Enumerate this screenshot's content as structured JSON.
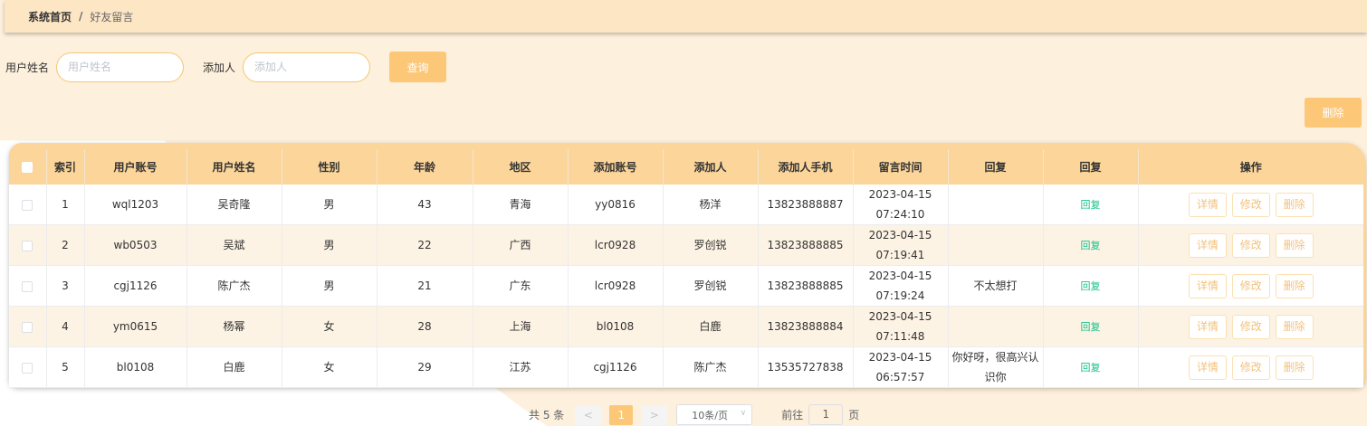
{
  "breadcrumb": {
    "home": "系统首页",
    "separator": "/",
    "current": "好友留言"
  },
  "search": {
    "user_name_label": "用户姓名",
    "user_name_placeholder": "用户姓名",
    "adder_label": "添加人",
    "adder_placeholder": "添加人",
    "query_button": "查询"
  },
  "actions": {
    "delete_button": "删除"
  },
  "table": {
    "headers": [
      "索引",
      "用户账号",
      "用户姓名",
      "性别",
      "年龄",
      "地区",
      "添加账号",
      "添加人",
      "添加人手机",
      "留言时间",
      "回复",
      "回复",
      "操作"
    ],
    "rows": [
      {
        "index": "1",
        "account": "wql1203",
        "name": "吴奇隆",
        "gender": "男",
        "age": "43",
        "region": "青海",
        "add_account": "yy0816",
        "adder": "杨洋",
        "phone": "13823888887",
        "time": "2023-04-15 07:24:10",
        "reply": "",
        "reply_link": "回复"
      },
      {
        "index": "2",
        "account": "wb0503",
        "name": "吴斌",
        "gender": "男",
        "age": "22",
        "region": "广西",
        "add_account": "lcr0928",
        "adder": "罗创锐",
        "phone": "13823888885",
        "time": "2023-04-15 07:19:41",
        "reply": "",
        "reply_link": "回复"
      },
      {
        "index": "3",
        "account": "cgj1126",
        "name": "陈广杰",
        "gender": "男",
        "age": "21",
        "region": "广东",
        "add_account": "lcr0928",
        "adder": "罗创锐",
        "phone": "13823888885",
        "time": "2023-04-15 07:19:24",
        "reply": "不太想打",
        "reply_link": "回复"
      },
      {
        "index": "4",
        "account": "ym0615",
        "name": "杨幂",
        "gender": "女",
        "age": "28",
        "region": "上海",
        "add_account": "bl0108",
        "adder": "白鹿",
        "phone": "13823888884",
        "time": "2023-04-15 07:11:48",
        "reply": "",
        "reply_link": "回复"
      },
      {
        "index": "5",
        "account": "bl0108",
        "name": "白鹿",
        "gender": "女",
        "age": "29",
        "region": "江苏",
        "add_account": "cgj1126",
        "adder": "陈广杰",
        "phone": "13535727838",
        "time": "2023-04-15 06:57:57",
        "reply": "你好呀，很高兴认识你",
        "reply_link": "回复"
      }
    ],
    "op_labels": {
      "detail": "详情",
      "edit": "修改",
      "delete": "删除"
    }
  },
  "pagination": {
    "total": "共 5 条",
    "prev": "<",
    "current_page": "1",
    "next": ">",
    "page_size": "10条/页",
    "goto_label": "前往",
    "goto_value": "1",
    "page_suffix": "页"
  },
  "colors": {
    "accent": "#fcc777",
    "header": "#fcd59a",
    "topbar": "#fde6c4",
    "reply_link": "#13c28b"
  }
}
